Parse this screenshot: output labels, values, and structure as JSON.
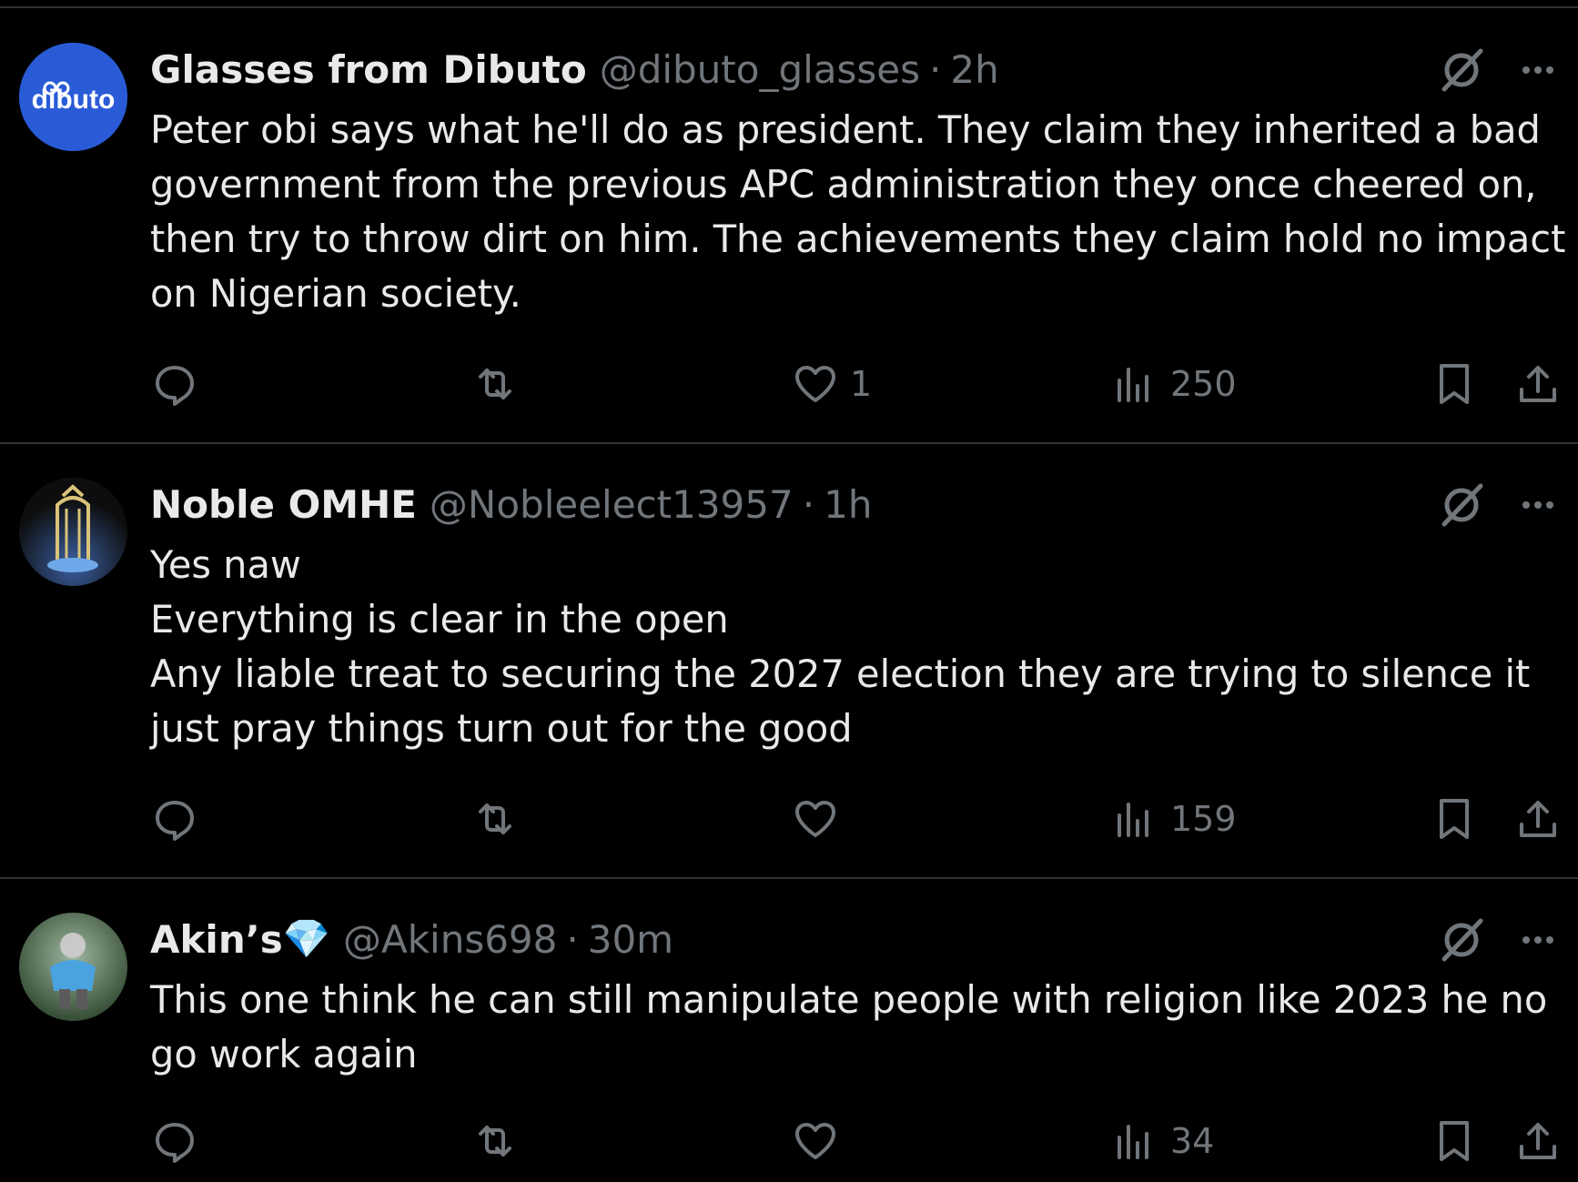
{
  "tweets": [
    {
      "name": "Glasses from Dibuto",
      "name_emoji": "",
      "handle": "@dibuto_glasses",
      "separator": "·",
      "time": "2h",
      "avatar_text": "dibuto",
      "lines": [
        "Peter obi says what he'll do as president. They claim they inherited a bad",
        "government from the previous APC administration they once cheered on,",
        "then try to throw dirt on him. The achievements they claim hold no impact",
        "on Nigerian society."
      ],
      "replies": "",
      "reposts": "",
      "likes": "1",
      "views": "250"
    },
    {
      "name": "Noble OMHE",
      "name_emoji": "",
      "handle": "@Nobleelect13957",
      "separator": "·",
      "time": "1h",
      "avatar_text": "",
      "lines": [
        "Yes naw",
        "Everything is clear in the open",
        "Any liable treat to securing the 2027 election they are trying to silence it",
        "just pray things turn out for the good"
      ],
      "replies": "",
      "reposts": "",
      "likes": "",
      "views": "159"
    },
    {
      "name": "Akin’s",
      "name_emoji": "💎",
      "handle": "@Akins698",
      "separator": "·",
      "time": "30m",
      "avatar_text": "",
      "lines": [
        "This one think he can still manipulate people with religion like 2023 he no",
        "go work again"
      ],
      "replies": "",
      "reposts": "",
      "likes": "",
      "views": "34"
    }
  ],
  "icons": {
    "reply": "reply-icon",
    "repost": "repost-icon",
    "like": "heart-icon",
    "views": "views-icon",
    "bookmark": "bookmark-icon",
    "share": "share-icon",
    "grok": "grok-icon",
    "more": "more-icon"
  },
  "colors": {
    "background": "#000000",
    "text": "#e7e9ea",
    "muted": "#71767b",
    "divider": "#2f3336",
    "dibuto_blue": "#1d4ed8",
    "diamond": "#4fc3f7"
  }
}
